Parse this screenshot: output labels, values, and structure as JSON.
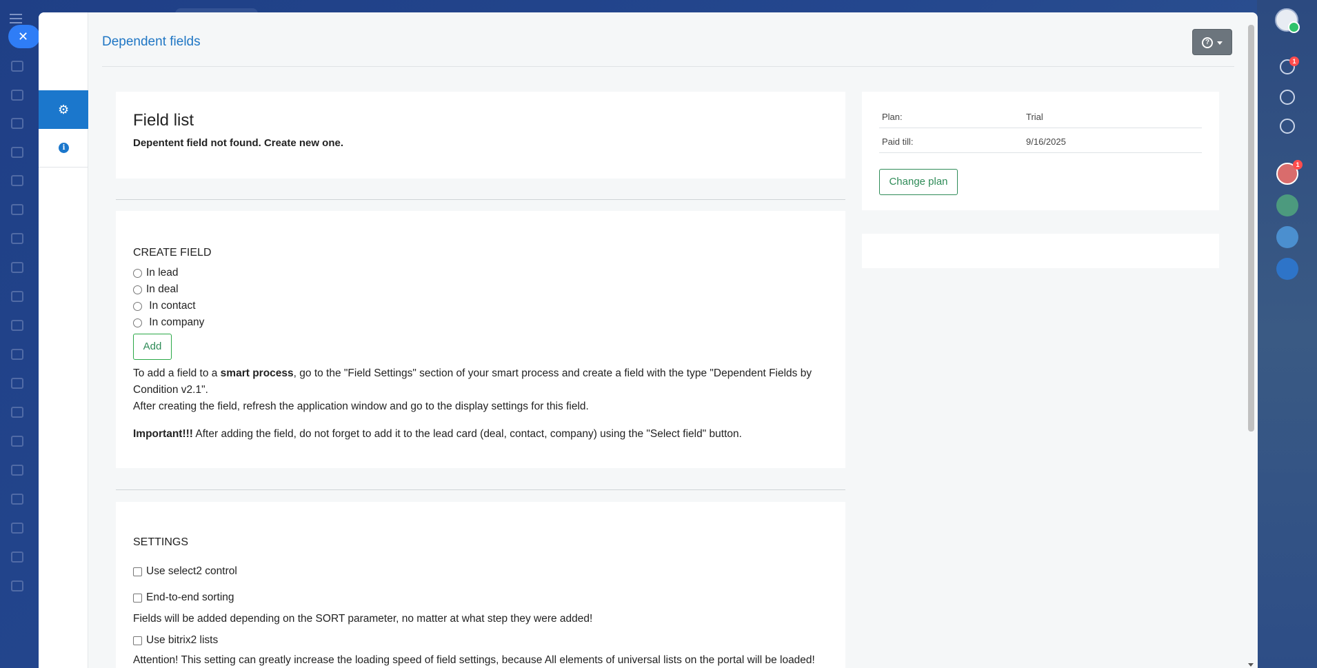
{
  "page": {
    "title": "Dependent fields"
  },
  "field_list": {
    "title": "Field list",
    "message": "Depentent field not found. Create new one."
  },
  "create_field": {
    "title": "CREATE FIELD",
    "options": [
      "In lead",
      "In deal",
      " In contact",
      " In company"
    ],
    "add_label": "Add",
    "note1_pre": "To add a field to a ",
    "note1_bold": "smart process",
    "note1_post": ", go to the \"Field Settings\" section of your smart process and create a field with the type \"Dependent Fields by Condition v2.1\".",
    "note2": "After creating the field, refresh the application window and go to the display settings for this field.",
    "important_bold": "Important!!!",
    "important_text": " After adding the field, do not forget to add it to the lead card (deal, contact, company) using the \"Select field\" button."
  },
  "settings": {
    "title": "SETTINGS",
    "select2_label": "Use select2 control",
    "sorting_label": "End-to-end sorting",
    "sorting_note": "Fields will be added depending on the SORT parameter, no matter at what step they were added!",
    "bitrix2_label": "Use bitrix2 lists",
    "bitrix2_note": "Attention! This setting can greatly increase the loading speed of field settings, because All elements of universal lists on the portal will be loaded!"
  },
  "plan": {
    "plan_label": "Plan:",
    "plan_value": "Trial",
    "paid_label": "Paid till:",
    "paid_value": "9/16/2025",
    "change_label": "Change plan"
  },
  "right_panel": {
    "notification_count": "1",
    "chat_count": "1"
  },
  "colors": {
    "accent": "#1b77cc",
    "success": "#2e8b57"
  }
}
